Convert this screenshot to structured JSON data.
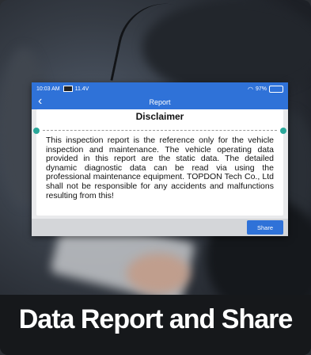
{
  "status": {
    "time": "10:03 AM",
    "voltage": "11.4V",
    "battery": "97%"
  },
  "header": {
    "back_icon": "chevron-left-icon",
    "title": "Report"
  },
  "disclaimer": {
    "title": "Disclaimer",
    "body": "This inspection report is the reference only for the vehicle inspection and maintenance. The vehicle operating data provided in this report are the static data. The detailed dynamic diagnostic data can be read via using the professional maintenance equipment. TOPDON Tech Co., Ltd shall not be responsible for any accidents and malfunctions resulting from this!"
  },
  "footer": {
    "share_label": "Share"
  },
  "caption": "Data Report and Share",
  "colors": {
    "accent": "#2f72d8",
    "teal_marker": "#2aa89a"
  }
}
